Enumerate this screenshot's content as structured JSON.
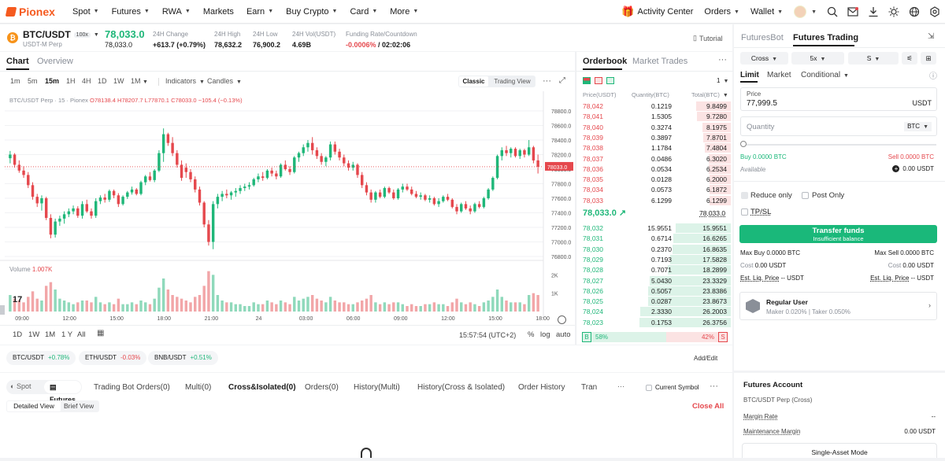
{
  "nav": {
    "brand": "Pionex",
    "menu": [
      "Spot",
      "Futures",
      "RWA",
      "Markets",
      "Earn",
      "Buy Crypto",
      "Card",
      "More"
    ],
    "menu_caret": [
      true,
      true,
      true,
      false,
      true,
      true,
      true,
      true
    ],
    "activity": "Activity Center",
    "orders": "Orders",
    "wallet": "Wallet"
  },
  "ticker": {
    "pair": "BTC/USDT",
    "leverage_badge": "100x",
    "subtitle": "USDT-M Perp",
    "price": "78,033.0",
    "price_sub": "78,033.0",
    "change_label": "24H Change",
    "change_value": "+613.7 (+0.79%)",
    "high_label": "24H High",
    "high_value": "78,632.2",
    "low_label": "24H Low",
    "low_value": "76,900.2",
    "vol_label": "24H Vol(USDT)",
    "vol_value": "4.69B",
    "funding_label": "Funding Rate/Countdown",
    "funding_rate": "-0.0006%",
    "funding_sep": " / ",
    "countdown": "02:02:06",
    "tutorial": "Tutorial"
  },
  "chart": {
    "tab_chart": "Chart",
    "tab_overview": "Overview",
    "timeframes": [
      "1m",
      "5m",
      "15m",
      "1H",
      "4H",
      "1D",
      "1W",
      "1M"
    ],
    "active_tf": "15m",
    "indicators": "Indicators",
    "candles": "Candles",
    "classic": "Classic",
    "tradingview": "Trading View",
    "legend_symbol": "BTC/USDT Perp · 15 · Pionex",
    "legend_o": "O78138.4",
    "legend_h": "H78207.7",
    "legend_l": "L77870.1",
    "legend_c": "C78033.0",
    "legend_chg": "−105.4 (−0.13%)",
    "volume_label": "Volume",
    "volume_value": "1.007K",
    "price_tag": "78033.0",
    "tv_logo": "17",
    "range_buttons": [
      "1D",
      "1W",
      "1M",
      "1 Y",
      "All"
    ],
    "clock": "15:57:54 (UTC+2)",
    "scale_opts": [
      "%",
      "log",
      "auto"
    ]
  },
  "chart_data": {
    "type": "candlestick",
    "ylim": [
      76800,
      78800
    ],
    "yticks": [
      78800,
      78600,
      78400,
      78200,
      78000,
      77800,
      77600,
      77400,
      77200,
      77000,
      76800
    ],
    "ytick_labels": [
      "78800.0",
      "78600.0",
      "78400.0",
      "78200.0",
      "78000.0",
      "77800.0",
      "77600.0",
      "77400.0",
      "77200.0",
      "77000.0",
      "76800.0"
    ],
    "vol_ticks": [
      "2K",
      "1K"
    ],
    "xtick_labels": [
      "09:00",
      "12:00",
      "15:00",
      "18:00",
      "21:00",
      "24",
      "03:00",
      "06:00",
      "09:00",
      "12:00",
      "15:00",
      "18:00"
    ],
    "vol_max": 2400,
    "candles": [
      [
        78150,
        78250,
        78080,
        78200,
        900
      ],
      [
        78200,
        78220,
        78020,
        78060,
        700
      ],
      [
        78060,
        78120,
        77950,
        77980,
        600
      ],
      [
        77980,
        78040,
        77880,
        77920,
        500
      ],
      [
        77920,
        77960,
        77740,
        77780,
        800
      ],
      [
        77780,
        77820,
        77580,
        77620,
        1100
      ],
      [
        77620,
        77660,
        77480,
        77530,
        700
      ],
      [
        77530,
        77640,
        77430,
        77600,
        600
      ],
      [
        77600,
        77620,
        77300,
        77330,
        1400
      ],
      [
        77330,
        77380,
        77050,
        77100,
        1600
      ],
      [
        77100,
        77320,
        77060,
        77280,
        1200
      ],
      [
        77280,
        77360,
        77220,
        77320,
        700
      ],
      [
        77320,
        77420,
        77250,
        77380,
        600
      ],
      [
        77380,
        77460,
        77340,
        77420,
        500
      ],
      [
        77420,
        77500,
        77380,
        77460,
        400
      ],
      [
        77460,
        77490,
        77330,
        77360,
        500
      ],
      [
        77360,
        77560,
        77320,
        77520,
        600
      ],
      [
        77520,
        77580,
        77400,
        77420,
        600
      ],
      [
        77420,
        77460,
        77320,
        77360,
        500
      ],
      [
        77360,
        77600,
        77330,
        77560,
        800
      ],
      [
        77560,
        77640,
        77520,
        77610,
        500
      ],
      [
        77610,
        77660,
        77540,
        77580,
        400
      ],
      [
        77580,
        77720,
        77550,
        77700,
        500
      ],
      [
        77700,
        77720,
        77600,
        77640,
        400
      ],
      [
        77640,
        77670,
        77480,
        77520,
        700
      ],
      [
        77520,
        77640,
        77500,
        77620,
        400
      ],
      [
        77620,
        77700,
        77590,
        77680,
        400
      ],
      [
        77680,
        77760,
        77650,
        77720,
        500
      ],
      [
        77720,
        77740,
        77640,
        77660,
        400
      ],
      [
        77660,
        77840,
        77640,
        77820,
        600
      ],
      [
        77820,
        77920,
        77780,
        77900,
        500
      ],
      [
        77900,
        77960,
        77830,
        77850,
        400
      ],
      [
        77850,
        78000,
        77820,
        77980,
        700
      ],
      [
        77980,
        78260,
        77960,
        78220,
        1300
      ],
      [
        78220,
        78560,
        78100,
        78480,
        1800
      ],
      [
        78480,
        78500,
        78320,
        78360,
        1200
      ],
      [
        78360,
        78440,
        78180,
        78220,
        900
      ],
      [
        78220,
        78260,
        78020,
        78060,
        800
      ],
      [
        78060,
        78120,
        77840,
        77880,
        700
      ],
      [
        78020,
        78080,
        77880,
        77960,
        600
      ],
      [
        77960,
        78000,
        77820,
        77860,
        500
      ],
      [
        77860,
        77900,
        77680,
        77720,
        800
      ],
      [
        77720,
        77760,
        77500,
        77540,
        900
      ],
      [
        77540,
        77560,
        77200,
        77240,
        1400
      ],
      [
        77240,
        77300,
        76950,
        77000,
        2200
      ],
      [
        77000,
        77560,
        76900,
        77520,
        2000
      ],
      [
        77520,
        77660,
        77460,
        77620,
        900
      ],
      [
        77620,
        77700,
        77560,
        77660,
        600
      ],
      [
        77660,
        77720,
        77600,
        77640,
        500
      ],
      [
        77640,
        77700,
        77580,
        77680,
        500
      ],
      [
        77680,
        77740,
        77620,
        77700,
        400
      ],
      [
        77700,
        77780,
        77660,
        77740,
        400
      ],
      [
        77740,
        77800,
        77700,
        77760,
        300
      ],
      [
        77760,
        77820,
        77720,
        77780,
        300
      ],
      [
        77780,
        77880,
        77760,
        77860,
        500
      ],
      [
        77860,
        77940,
        77820,
        77900,
        400
      ],
      [
        77900,
        77960,
        77840,
        77880,
        400
      ],
      [
        77880,
        78000,
        77860,
        77980,
        600
      ],
      [
        77980,
        78020,
        77900,
        77940,
        500
      ],
      [
        77940,
        77980,
        77860,
        77900,
        400
      ],
      [
        77900,
        78080,
        77880,
        78060,
        600
      ],
      [
        78060,
        78120,
        77980,
        78000,
        500
      ],
      [
        78000,
        78040,
        77920,
        77960,
        400
      ],
      [
        77960,
        78180,
        77940,
        78160,
        800
      ],
      [
        78160,
        78240,
        78100,
        78220,
        600
      ],
      [
        78220,
        78340,
        78180,
        78300,
        700
      ],
      [
        78300,
        78400,
        78240,
        78360,
        800
      ],
      [
        78360,
        78440,
        78200,
        78260,
        900
      ],
      [
        78260,
        78300,
        78140,
        78180,
        700
      ],
      [
        78180,
        78220,
        78060,
        78100,
        600
      ],
      [
        78100,
        78180,
        78040,
        78160,
        500
      ],
      [
        78160,
        78380,
        78120,
        78340,
        800
      ],
      [
        78340,
        78380,
        78200,
        78240,
        600
      ],
      [
        78240,
        78280,
        78120,
        78160,
        500
      ],
      [
        78160,
        78200,
        78040,
        78080,
        500
      ],
      [
        78080,
        78120,
        77980,
        78020,
        400
      ],
      [
        78020,
        78100,
        77980,
        78060,
        400
      ],
      [
        78060,
        78080,
        77880,
        77920,
        500
      ],
      [
        77920,
        77960,
        77740,
        77780,
        600
      ],
      [
        77780,
        77820,
        77640,
        77680,
        700
      ],
      [
        77680,
        77720,
        77540,
        77580,
        900
      ],
      [
        77580,
        77700,
        77540,
        77680,
        500
      ],
      [
        77680,
        77720,
        77600,
        77620,
        400
      ],
      [
        77620,
        77760,
        77600,
        77740,
        500
      ],
      [
        77740,
        77760,
        77660,
        77680,
        400
      ],
      [
        77680,
        77720,
        77580,
        77600,
        500
      ],
      [
        77600,
        77740,
        77580,
        77720,
        500
      ],
      [
        77720,
        77800,
        77680,
        77760,
        400
      ],
      [
        77760,
        77800,
        77700,
        77720,
        300
      ],
      [
        77720,
        77760,
        77640,
        77660,
        400
      ],
      [
        77660,
        77700,
        77600,
        77620,
        300
      ],
      [
        77620,
        77680,
        77580,
        77640,
        300
      ],
      [
        77640,
        77660,
        77560,
        77580,
        400
      ],
      [
        77580,
        77640,
        77540,
        77600,
        400
      ],
      [
        77600,
        77620,
        77500,
        77520,
        500
      ],
      [
        77520,
        77600,
        77480,
        77560,
        400
      ],
      [
        77560,
        77640,
        77540,
        77620,
        400
      ],
      [
        77620,
        77660,
        77560,
        77580,
        300
      ],
      [
        77580,
        77600,
        77460,
        77480,
        500
      ],
      [
        77480,
        77520,
        77380,
        77420,
        700
      ],
      [
        77420,
        77540,
        77400,
        77520,
        500
      ],
      [
        77520,
        77560,
        77440,
        77460,
        400
      ],
      [
        77460,
        77500,
        77380,
        77420,
        500
      ],
      [
        77420,
        77540,
        77400,
        77520,
        400
      ],
      [
        77520,
        77560,
        77460,
        77480,
        300
      ],
      [
        77480,
        77620,
        77460,
        77600,
        500
      ],
      [
        77600,
        77740,
        77580,
        77720,
        600
      ],
      [
        77720,
        77900,
        77700,
        77880,
        800
      ],
      [
        77880,
        78200,
        77860,
        78180,
        1200
      ],
      [
        78180,
        78300,
        78120,
        78260,
        800
      ],
      [
        78260,
        78320,
        78180,
        78220,
        600
      ],
      [
        78220,
        78300,
        78160,
        78280,
        500
      ],
      [
        78280,
        78300,
        78160,
        78180,
        500
      ],
      [
        78180,
        78280,
        78140,
        78260,
        500
      ],
      [
        78260,
        78280,
        78160,
        78200,
        400
      ],
      [
        78200,
        78400,
        78180,
        78300,
        900
      ],
      [
        78300,
        78320,
        78080,
        78120,
        1000
      ],
      [
        78120,
        78200,
        77940,
        78033,
        900
      ]
    ]
  },
  "orderbook": {
    "tab_ob": "Orderbook",
    "tab_trades": "Market Trades",
    "depth": "1",
    "col_price": "Price(USDT)",
    "col_qty": "Quantity(BTC)",
    "col_total": "Total(BTC)",
    "asks": [
      [
        "78,042",
        "0.1219",
        "9.8499"
      ],
      [
        "78,041",
        "1.5305",
        "9.7280"
      ],
      [
        "78,040",
        "0.3274",
        "8.1975"
      ],
      [
        "78,039",
        "0.3897",
        "7.8701"
      ],
      [
        "78,038",
        "1.1784",
        "7.4804"
      ],
      [
        "78,037",
        "0.0486",
        "6.3020"
      ],
      [
        "78,036",
        "0.0534",
        "6.2534"
      ],
      [
        "78,035",
        "0.0128",
        "6.2000"
      ],
      [
        "78,034",
        "0.0573",
        "6.1872"
      ],
      [
        "78,033",
        "6.1299",
        "6.1299"
      ]
    ],
    "ask_depth": [
      0.375,
      0.37,
      0.312,
      0.299,
      0.284,
      0.24,
      0.238,
      0.236,
      0.235,
      0.233
    ],
    "mid_price": "78,033.0",
    "mid_arrow": "↗",
    "mark_price": "78,033.0",
    "bids": [
      [
        "78,032",
        "15.9551",
        "15.9551"
      ],
      [
        "78,031",
        "0.6714",
        "16.6265"
      ],
      [
        "78,030",
        "0.2370",
        "16.8635"
      ],
      [
        "78,029",
        "0.7193",
        "17.5828"
      ],
      [
        "78,028",
        "0.7071",
        "18.2899"
      ],
      [
        "78,027",
        "5.0430",
        "23.3329"
      ],
      [
        "78,026",
        "0.5057",
        "23.8386"
      ],
      [
        "78,025",
        "0.0287",
        "23.8673"
      ],
      [
        "78,024",
        "2.3330",
        "26.2003"
      ],
      [
        "78,023",
        "0.1753",
        "26.3756"
      ]
    ],
    "bid_depth": [
      0.605,
      0.63,
      0.64,
      0.667,
      0.693,
      0.885,
      0.904,
      0.905,
      0.993,
      1.0
    ],
    "buy_letter": "B",
    "buy_pct": "58%",
    "sell_pct": "42%",
    "sell_letter": "S",
    "buy_ratio": 0.58
  },
  "watchlist": {
    "items": [
      {
        "pair": "BTC/USDT",
        "chg": "+0.78%",
        "up": true
      },
      {
        "pair": "ETH/USDT",
        "chg": "-0.03%",
        "up": false
      },
      {
        "pair": "BNB/USDT",
        "chg": "+0.51%",
        "up": true
      }
    ],
    "add_edit": "Add/Edit"
  },
  "trade": {
    "tab_bot": "FuturesBot",
    "tab_futures": "Futures Trading",
    "margin_mode": "Cross",
    "leverage": "5x",
    "side_mode": "S",
    "order_types": [
      "Limit",
      "Market",
      "Conditional"
    ],
    "price_label": "Price",
    "price_value": "77,999.5",
    "price_unit": "USDT",
    "qty_placeholder": "Quantity",
    "qty_unit": "BTC",
    "buy_avail": "Buy 0.0000 BTC",
    "sell_avail": "Sell 0.0000 BTC",
    "available_label": "Available",
    "available_value": "0.00 USDT",
    "reduce_only": "Reduce only",
    "post_only": "Post Only",
    "tpsl": "TP/SL",
    "transfer_title": "Transfer funds",
    "transfer_sub": "Insufficient balance",
    "max_buy": "Max Buy 0.0000 BTC",
    "max_sell": "Max Sell 0.0000 BTC",
    "cost_label": "Cost",
    "cost_value": "0.00 USDT",
    "liq_label": "Est. Liq. Price",
    "liq_value": "-- USDT",
    "user_tier": "Regular User",
    "maker_fee": "Maker 0.020%",
    "taker_fee": "Taker 0.050%"
  },
  "bottom": {
    "spot": "Spot",
    "futures": "Futures",
    "tabs": [
      "Trading Bot Orders(0)",
      "Multi(0)",
      "Cross&Isolated(0)",
      "Orders(0)",
      "History(Multi)",
      "History(Cross & Isolated)",
      "Order History",
      "Tran"
    ],
    "active_tab": "Cross&Isolated(0)",
    "current_symbol": "Current Symbol",
    "detailed_view": "Detailed View",
    "brief_view": "Brief View",
    "close_all": "Close All"
  },
  "account": {
    "title": "Futures Account",
    "symbol": "BTC/USDT Perp (Cross)",
    "margin_rate_label": "Margin Rate",
    "margin_rate_value": "--",
    "maint_label": "Maintenance Margin",
    "maint_value": "0.00 USDT",
    "asset_mode": "Single-Asset Mode"
  },
  "colors": {
    "up": "#1fb779",
    "down": "#e5484d",
    "brand": "#f55a1f",
    "accent": "#1ab87a"
  }
}
